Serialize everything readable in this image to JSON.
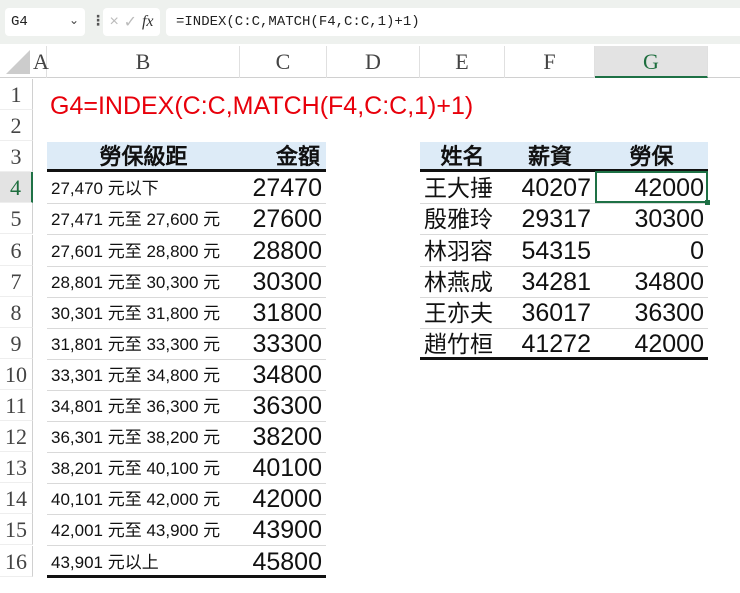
{
  "formula_bar": {
    "name_box": "G4",
    "formula": "=INDEX(C:C,MATCH(F4,C:C,1)+1)",
    "cancel_icon": "×",
    "enter_icon": "✓",
    "fx_label": "fx"
  },
  "columns": [
    "A",
    "B",
    "C",
    "D",
    "E",
    "F",
    "G"
  ],
  "rows": [
    "1",
    "2",
    "3",
    "4",
    "5",
    "6",
    "7",
    "8",
    "9",
    "10",
    "11",
    "12",
    "13",
    "14",
    "15",
    "16"
  ],
  "title": "G4=INDEX(C:C,MATCH(F4,C:C,1)+1)",
  "bracket_table": {
    "headers": [
      "勞保級距",
      "金額"
    ],
    "rows": [
      [
        "27,470 元以下",
        "27470"
      ],
      [
        "27,471 元至 27,600 元",
        "27600"
      ],
      [
        "27,601 元至 28,800 元",
        "28800"
      ],
      [
        "28,801 元至 30,300 元",
        "30300"
      ],
      [
        "30,301 元至 31,800 元",
        "31800"
      ],
      [
        "31,801 元至 33,300 元",
        "33300"
      ],
      [
        "33,301 元至 34,800 元",
        "34800"
      ],
      [
        "34,801 元至 36,300 元",
        "36300"
      ],
      [
        "36,301 元至 38,200 元",
        "38200"
      ],
      [
        "38,201 元至 40,100 元",
        "40100"
      ],
      [
        "40,101 元至 42,000 元",
        "42000"
      ],
      [
        "42,001 元至 43,900 元",
        "43900"
      ],
      [
        "43,901 元以上",
        "45800"
      ]
    ]
  },
  "employee_table": {
    "headers": [
      "姓名",
      "薪資",
      "勞保"
    ],
    "rows": [
      [
        "王大捶",
        "40207",
        "42000"
      ],
      [
        "殷雅玲",
        "29317",
        "30300"
      ],
      [
        "林羽容",
        "54315",
        "0"
      ],
      [
        "林燕成",
        "34281",
        "34800"
      ],
      [
        "王亦夫",
        "36017",
        "36300"
      ],
      [
        "趙竹桓",
        "41272",
        "42000"
      ]
    ]
  }
}
